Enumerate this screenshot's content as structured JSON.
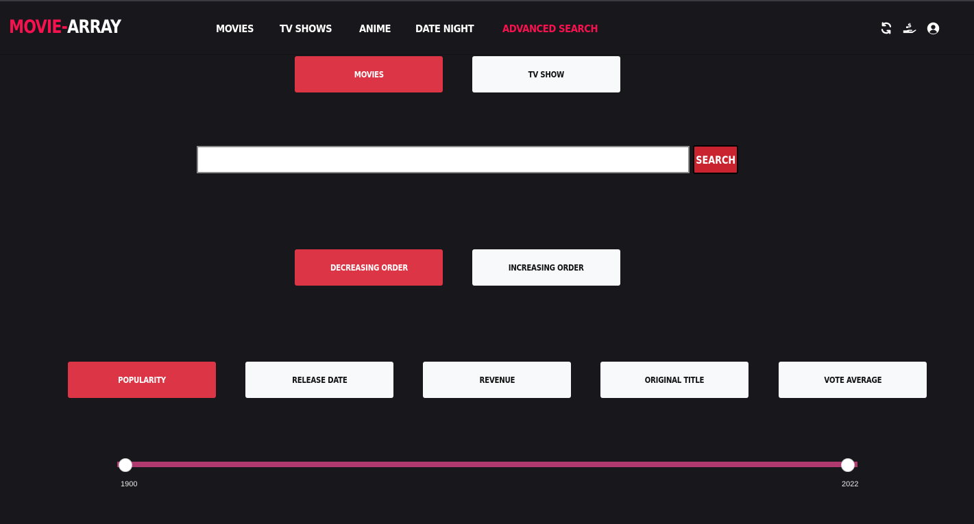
{
  "header": {
    "logo_accent": "MOVIE-",
    "logo_rest": "ARRAY",
    "nav": [
      "MOVIES",
      "TV SHOWS",
      "ANIME",
      "DATE NIGHT",
      "ADVANCED SEARCH"
    ],
    "active_nav": "ADVANCED SEARCH",
    "icons": [
      "refresh-icon",
      "donate-icon",
      "user-account-icon"
    ]
  },
  "media_type": {
    "options": [
      "MOVIES",
      "TV SHOW"
    ],
    "selected": "MOVIES"
  },
  "search": {
    "value": "",
    "button_label": "SEARCH"
  },
  "order": {
    "options": [
      "DECREASING ORDER",
      "INCREASING ORDER"
    ],
    "selected": "DECREASING ORDER"
  },
  "sort_by": {
    "options": [
      "POPULARITY",
      "RELEASE DATE",
      "REVENUE",
      "ORIGINAL TITLE",
      "VOTE AVERAGE"
    ],
    "selected": "POPULARITY"
  },
  "year_range": {
    "min_label": "1900",
    "max_label": "2022",
    "min": 1900,
    "max": 2022,
    "from": 1900,
    "to": 2022
  },
  "colors": {
    "background": "#18171c",
    "accent": "#f5124f",
    "button_selected": "#dc3545",
    "button_unselected": "#f8f9fa",
    "slider_track": "#b03a6e"
  }
}
